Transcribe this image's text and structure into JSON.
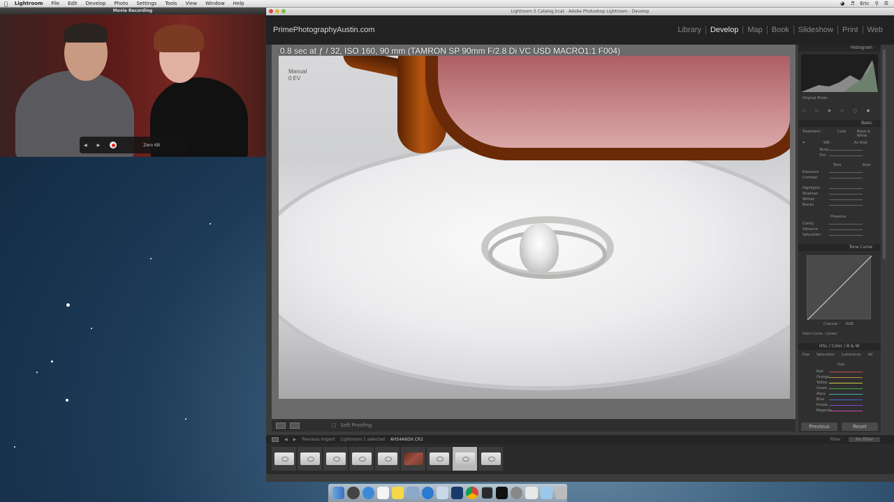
{
  "menubar": {
    "apple": "",
    "items": [
      "Lightroom",
      "File",
      "Edit",
      "Develop",
      "Photo",
      "Settings",
      "Tools",
      "View",
      "Window",
      "Help"
    ],
    "right": [
      "Eric"
    ]
  },
  "movie_window": {
    "title": "Movie Recording",
    "size_label": "Zero KB"
  },
  "lightroom": {
    "window_title": "Lightroom 5 Catalog.lrcat - Adobe Photoshop Lightroom - Develop",
    "identity_plate": "PrimePhotographyAustin.com",
    "modules": [
      {
        "label": "Library",
        "active": false
      },
      {
        "label": "Develop",
        "active": true
      },
      {
        "label": "Map",
        "active": false
      },
      {
        "label": "Book",
        "active": false
      },
      {
        "label": "Slideshow",
        "active": false
      },
      {
        "label": "Print",
        "active": false
      },
      {
        "label": "Web",
        "active": false
      }
    ],
    "photo_info": "0.8 sec at ƒ / 32, ISO 160, 90 mm (TAMRON SP 90mm F/2.8 Di VC USD MACRO1:1 F004)",
    "photo_sub1": "Manual",
    "photo_sub2": "0 EV",
    "toolbar_label": "Soft Proofing",
    "panel": {
      "histogram": "Histogram",
      "original_photo": "Original Photo",
      "basic": "Basic",
      "treatment": "Treatment :",
      "treatment_color": "Color",
      "treatment_bw": "Black & White",
      "wb": "WB :",
      "wb_value": "As Shot",
      "temp": "Temp",
      "tint": "Tint",
      "tone": "Tone",
      "auto": "Auto",
      "tone_sliders": [
        "Exposure",
        "Contrast",
        "Highlights",
        "Shadows",
        "Whites",
        "Blacks"
      ],
      "presence": "Presence",
      "presence_sliders": [
        "Clarity",
        "Vibrance",
        "Saturation"
      ],
      "tone_curve": "Tone Curve",
      "channel": "Channel :",
      "channel_value": "RGB",
      "point_curve": "Point Curve :",
      "point_curve_value": "Linear",
      "hsl": "HSL",
      "color": "Color",
      "bw": "B & W",
      "hsl_tabs": [
        "Hue",
        "Saturation",
        "Luminance",
        "All"
      ],
      "hue": "Hue",
      "hsl_sliders": [
        "Red",
        "Orange",
        "Yellow",
        "Green",
        "Aqua",
        "Blue",
        "Purple",
        "Magenta"
      ],
      "previous": "Previous",
      "reset": "Reset"
    },
    "filmstrip_bar": {
      "source": "Previous Import",
      "count": "Lightroom 1 selected",
      "filename": "AHS4A6DX.CR2",
      "filter": "Filter :",
      "filter_value": "No Filter"
    }
  }
}
